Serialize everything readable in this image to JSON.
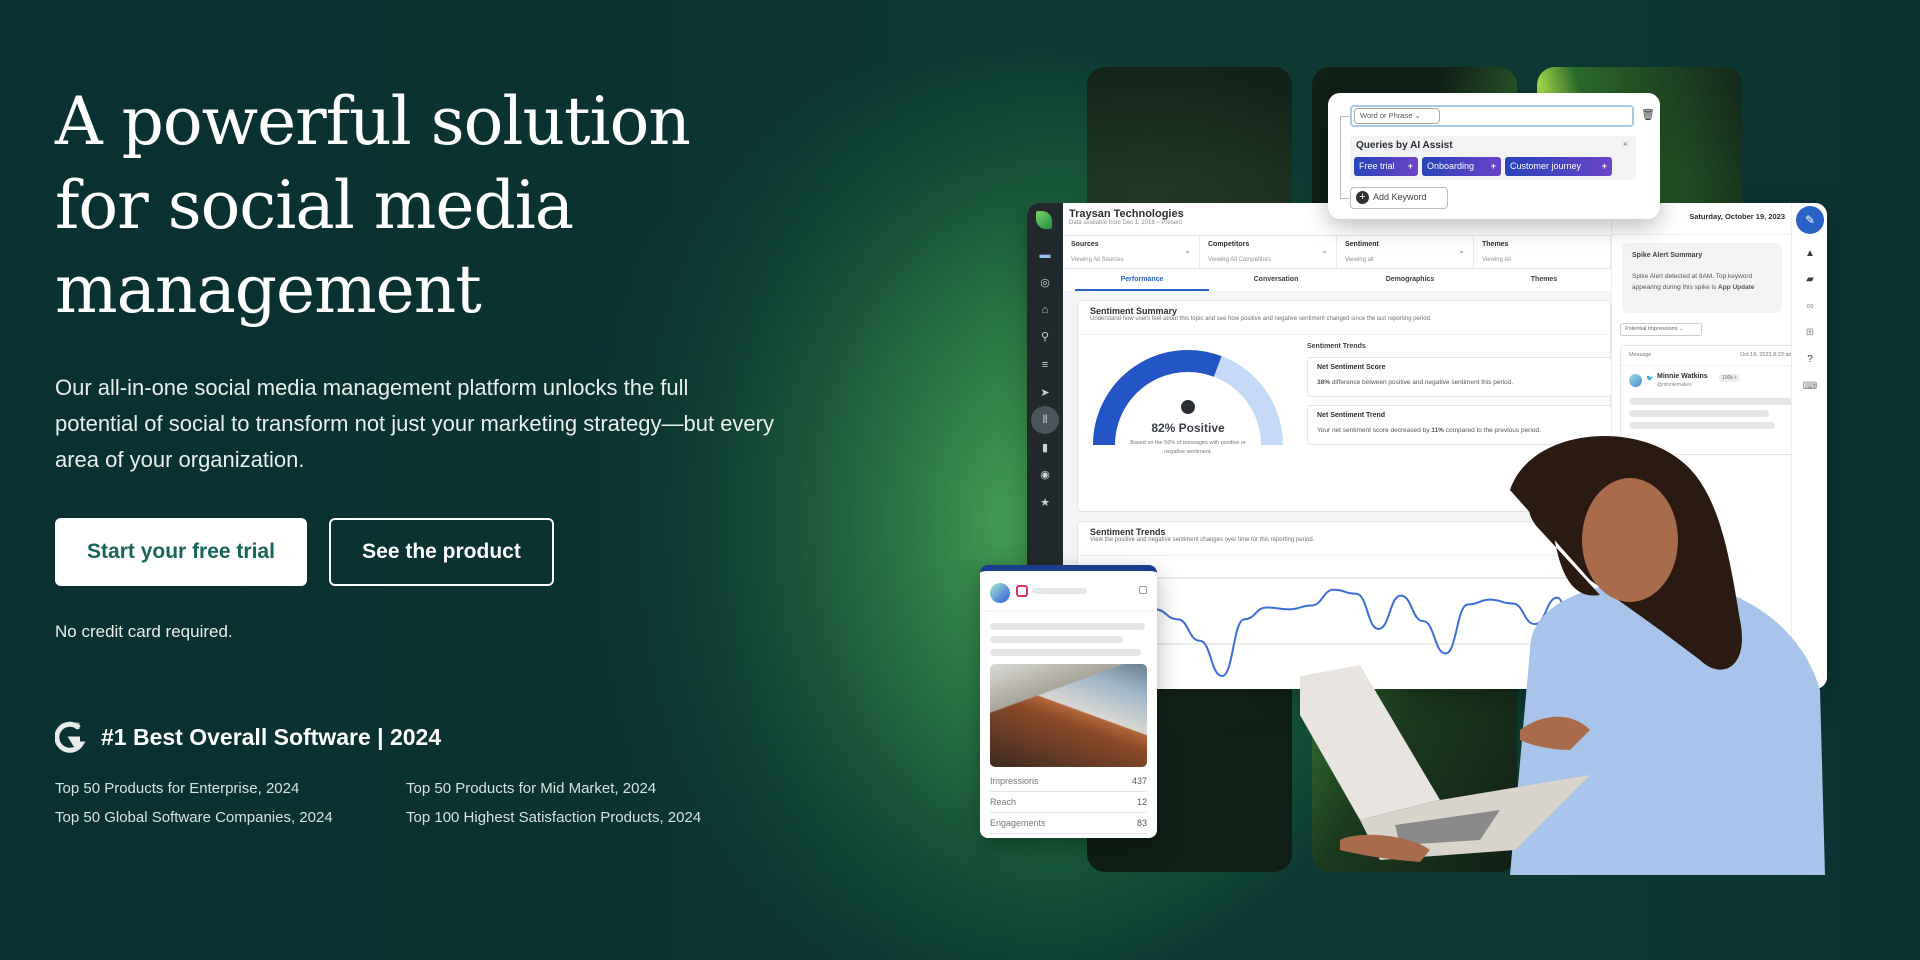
{
  "hero": {
    "headline_lines": [
      "A powerful solution",
      "for social media",
      "management"
    ],
    "subtext": "Our all-in-one social media management platform unlocks the full potential of social to transform not just your marketing strategy—but every area of your organization.",
    "primary_cta": "Start your free trial",
    "secondary_cta": "See the product",
    "note": "No credit card required."
  },
  "award": {
    "icon": "g2-logo-icon",
    "title": "#1 Best Overall Software | 2024",
    "items": [
      "Top 50 Products for Enterprise, 2024",
      "Top 50 Products for Mid Market, 2024",
      "Top 50 Global Software Companies, 2024",
      "Top 100 Highest Satisfaction Products, 2024"
    ]
  },
  "colors": {
    "background": "#0a3331",
    "glow": "#4aa655",
    "primary_text": "#17645a",
    "accent_blue": "#2b62c5",
    "chip_gradient_start": "#2644b8",
    "chip_gradient_end": "#6d43c9"
  },
  "dashboard": {
    "company": "Traysan Technologies",
    "company_sub": "Data available from Dec 1, 2018 – Present",
    "filters": [
      {
        "label": "Sources",
        "value": "Viewing All Sources"
      },
      {
        "label": "Competitors",
        "value": "Viewing All Competitors"
      },
      {
        "label": "Sentiment",
        "value": "Viewing all"
      },
      {
        "label": "Themes",
        "value": "Viewing All"
      }
    ],
    "tabs": [
      "Performance",
      "Conversation",
      "Demographics",
      "Themes"
    ],
    "active_tab": "Performance",
    "summary_title": "Sentiment Summary",
    "summary_sub": "Understand how users feel about this topic and see how positive and negative sentiment changed since the last reporting period.",
    "gauge_label": "82% Positive",
    "gauge_value": 0.82,
    "gauge_note": "Based on the 56% of messages with positive or negative sentiment.",
    "trends_label": "Sentiment Trends",
    "net_score_title": "Net Sentiment Score",
    "net_score_bold": "38%",
    "net_score_text": " difference between positive and negative sentiment this period.",
    "net_trend_title": "Net Sentiment Trend",
    "net_trend_text_a": "Your net sentiment score decreased by ",
    "net_trend_bold": "11%",
    "net_trend_text_b": " compared to the previous period.",
    "trends_title": "Sentiment Trends",
    "trends_sub": "View the positive and negative sentiment changes over time for this reporting period.",
    "trend_series": [
      0.72,
      0.66,
      0.82,
      0.7,
      0.6,
      0.38,
      0.02,
      0.6,
      0.72,
      0.7,
      0.74,
      0.9,
      0.86,
      0.5,
      0.84,
      0.58,
      0.25,
      0.75,
      0.8,
      0.76,
      0.55,
      0.82,
      0.05,
      0.4
    ]
  },
  "side_panel": {
    "date": "Saturday, October 19, 2023",
    "spike_title": "Spike Alert Summary",
    "spike_text": "Spike Alert detected at 8AM. Top keyword appearing during this spike is ",
    "spike_keyword": "App Update",
    "dropdown": "Potential Impressions",
    "msg_header": "Message",
    "msg_date": "Oct 19, 2023 8:23 am",
    "author": "Minnie Watkins",
    "handle": "@minniemakes",
    "followers": "100k +"
  },
  "query_builder": {
    "select": "Word or Phrase",
    "ai_title": "Queries by AI Assist",
    "chips": [
      "Free trial",
      "Onboarding",
      "Customer journey"
    ],
    "add_label": "Add Keyword"
  },
  "post_card": {
    "stats": [
      {
        "label": "Impressions",
        "value": "437"
      },
      {
        "label": "Reach",
        "value": "12"
      },
      {
        "label": "Engagements",
        "value": "83"
      }
    ]
  }
}
